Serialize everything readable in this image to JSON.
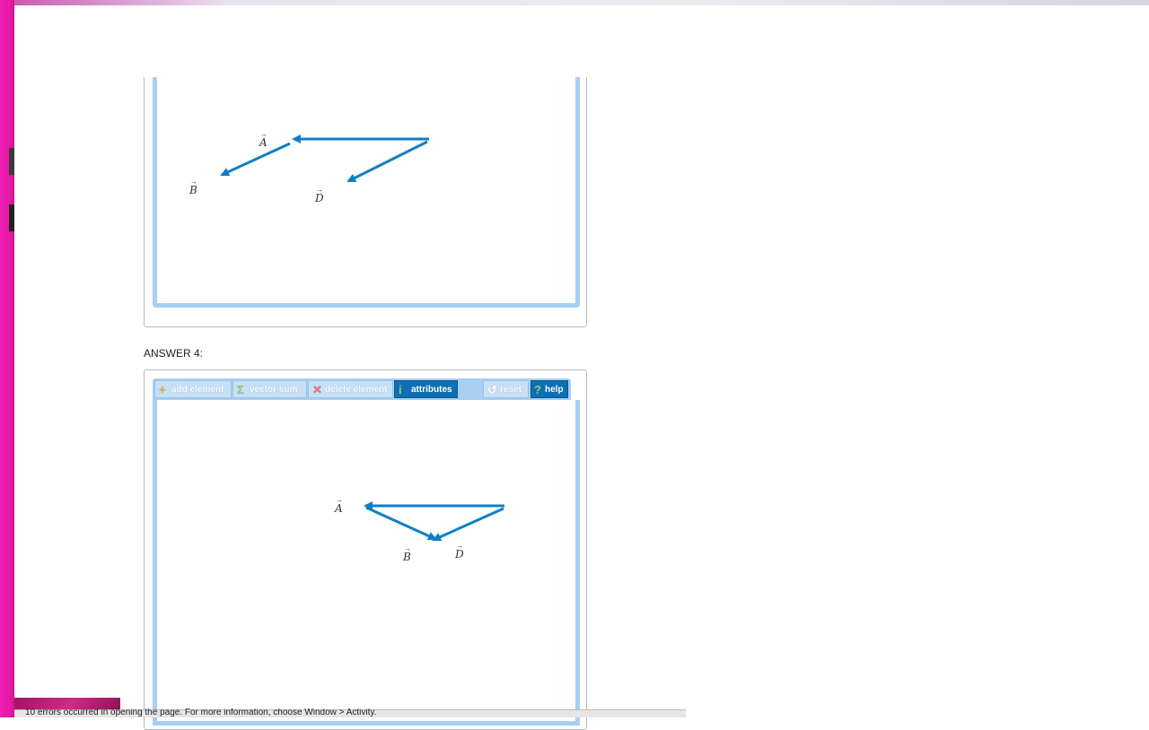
{
  "answer_label": "ANSWER 4:",
  "toolbar": {
    "add_element": "add element",
    "vector_sum": "vector sum",
    "delete_element": "delete element",
    "attributes": "attributes",
    "reset": "reset",
    "help": "help"
  },
  "diagram_top": {
    "labels": [
      "A",
      "B",
      "D"
    ]
  },
  "diagram_bottom": {
    "labels": [
      "A",
      "B",
      "D"
    ]
  },
  "status": {
    "message": "10 errors occurred in opening the page. For more information, choose Window > Activity."
  },
  "colors": {
    "vector": "#0f7fc4",
    "canvas_border": "#a6cff3",
    "toolbar_active": "#0f6fb3"
  }
}
